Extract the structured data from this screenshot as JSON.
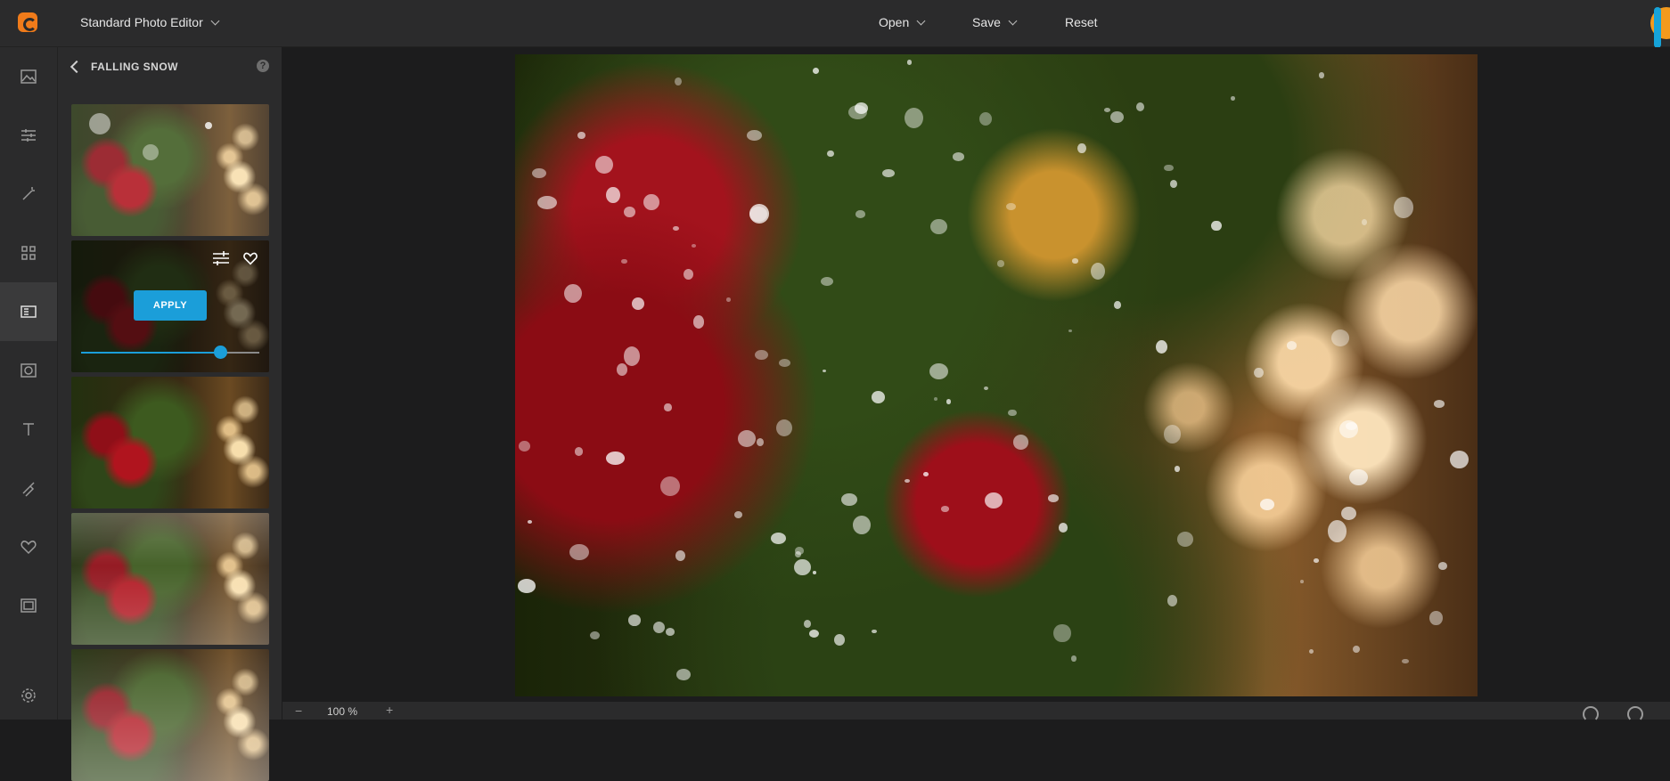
{
  "header": {
    "app_title": "Standard Photo Editor",
    "menu": [
      {
        "label": "Open"
      },
      {
        "label": "Save"
      },
      {
        "label": "Reset"
      }
    ]
  },
  "rail": {
    "icons": [
      "image-icon",
      "adjustments-icon",
      "magic-wand-icon",
      "grid-icon",
      "textures-icon",
      "frame-icon",
      "text-icon",
      "brush-icon",
      "heart-icon",
      "border-icon",
      "settings-icon"
    ],
    "active": "textures-icon"
  },
  "panel": {
    "title": "FALLING SNOW",
    "help": "?",
    "apply_label": "APPLY",
    "intensity_percent": 78
  },
  "zoom": {
    "minus": "−",
    "value": "100 %",
    "plus": "+"
  },
  "colors": {
    "accent": "#1b9ed9",
    "logo": "#f07b1a",
    "bg": "#1c1c1d",
    "panel": "#2b2b2c"
  }
}
